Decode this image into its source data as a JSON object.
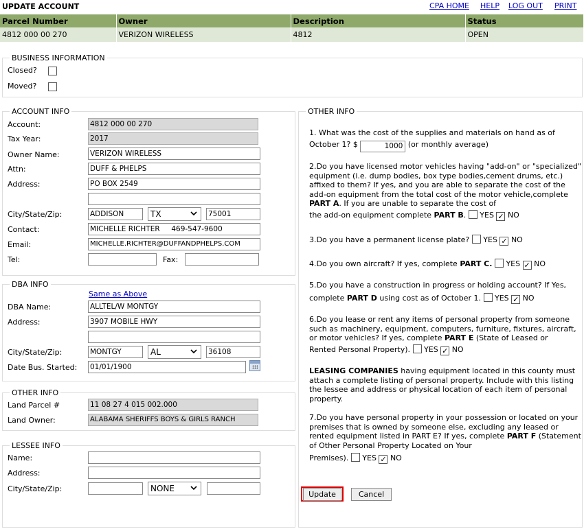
{
  "page": {
    "title": "UPDATE ACCOUNT",
    "links": {
      "cpa_home": "CPA HOME",
      "help": "HELP",
      "logout": "LOG OUT",
      "print": "PRINT"
    }
  },
  "parcel_table": {
    "headers": [
      "Parcel Number",
      "Owner",
      "Description",
      "Status"
    ],
    "row": [
      "4812 000 00 270",
      "VERIZON WIRELESS",
      "4812",
      "OPEN"
    ]
  },
  "business_info": {
    "legend": "BUSINESS INFORMATION",
    "closed_label": "Closed?",
    "moved_label": "Moved?",
    "closed_checked": false,
    "moved_checked": false
  },
  "account_info": {
    "legend": "ACCOUNT INFO",
    "account_label": "Account:",
    "account_value": "4812 000 00 270",
    "tax_year_label": "Tax Year:",
    "tax_year_value": "2017",
    "owner_name_label": "Owner Name:",
    "owner_name_value": "VERIZON WIRELESS",
    "attn_label": "Attn:",
    "attn_value": "DUFF & PHELPS",
    "address_label": "Address:",
    "address1_value": "PO BOX 2549",
    "address2_value": "",
    "csz_label": "City/State/Zip:",
    "city_value": "ADDISON",
    "state_value": "TX",
    "zip_value": "75001",
    "contact_label": "Contact:",
    "contact_value": "MICHELLE RICHTER     469-547-9600",
    "email_label": "Email:",
    "email_value": "MICHELLE.RICHTER@DUFFANDPHELPS.COM",
    "tel_label": "Tel:",
    "tel_value": "",
    "fax_label": "Fax:",
    "fax_value": ""
  },
  "dba_info": {
    "legend": "DBA INFO",
    "same_as_above": "Same as Above",
    "dba_name_label": "DBA Name:",
    "dba_name_value": "ALLTEL/W MONTGY",
    "address_label": "Address:",
    "address1_value": "3907 MOBILE HWY",
    "address2_value": "",
    "csz_label": "City/State/Zip:",
    "city_value": "MONTGY",
    "state_value": "AL",
    "zip_value": "36108",
    "date_label": "Date Bus. Started:",
    "date_value": "01/01/1900"
  },
  "other_info_left": {
    "legend": "OTHER INFO",
    "land_parcel_label": "Land Parcel #",
    "land_parcel_value": "11 08 27 4 015 002.000",
    "land_owner_label": "Land Owner:",
    "land_owner_value": "ALABAMA SHERIFFS BOYS & GIRLS RANCH"
  },
  "lessee_info": {
    "legend": "LESSEE INFO",
    "name_label": "Name:",
    "address_label": "Address:",
    "csz_label": "City/State/Zip:",
    "name_value": "",
    "address_value": "",
    "city_value": "",
    "state_value": "NONE",
    "zip_value": ""
  },
  "other_info_right": {
    "legend": "OTHER INFO",
    "q1_text": "1. What was the cost of the supplies and materials on hand as of",
    "q1_prefix": "October 1? $",
    "q1_value": "1000",
    "q1_suffix": "(or monthly average)",
    "q2_text": "2.Do you have licensed motor vehicles having \"add-on\" or \"specialized\" equipment (i.e. dump bodies, box type bodies,cement drums, etc.) affixed to them? If yes, and you are able to separate the cost of the add-on equipment from the total cost of the motor vehicle,complete ",
    "q2_bold1": "PART A",
    "q2_mid": ". If you are unable to separate the cost of",
    "q2_line_end": "the add-on equipment complete ",
    "q2_bold2": "PART B",
    "q3_text": "3.Do you have a permanent license plate?",
    "q4_text": "4.Do you own aircraft?  If yes, complete ",
    "q4_bold": "PART C.",
    "q5_text": "5.Do you have a construction in progress or holding account? If Yes,",
    "q5_line2": "complete ",
    "q5_bold": "PART D",
    "q5_after": " using cost as of October 1.",
    "q6_text": "6.Do you lease or rent any items of personal property from someone such as machinery, equipment, computers, furniture, fixtures, aircraft, or motor vehicles? If yes, complete ",
    "q6_bold": "PART E",
    "q6_after": " (State of Leased or",
    "q6_line_end": "Rented Personal Property).",
    "leasing_bold": "LEASING COMPANIES",
    "leasing_text": " having equipment located in this county must attach a complete listing of personal property. Include with this listing the lessee and address or physical location of each item of personal property.",
    "q7_text": "7.Do you have personal property in your possession or located on your premises that is owned by someone else, excluding any leased or rented equipment listed in PART E? If yes, complete ",
    "q7_bold": "PART F",
    "q7_after": " (Statement of Other Personal Property Located on Your",
    "q7_line_end": "Premises).",
    "yes_label": "YES",
    "no_label": "NO",
    "check_mark": "✓"
  },
  "buttons": {
    "update": "Update",
    "cancel": "Cancel"
  }
}
